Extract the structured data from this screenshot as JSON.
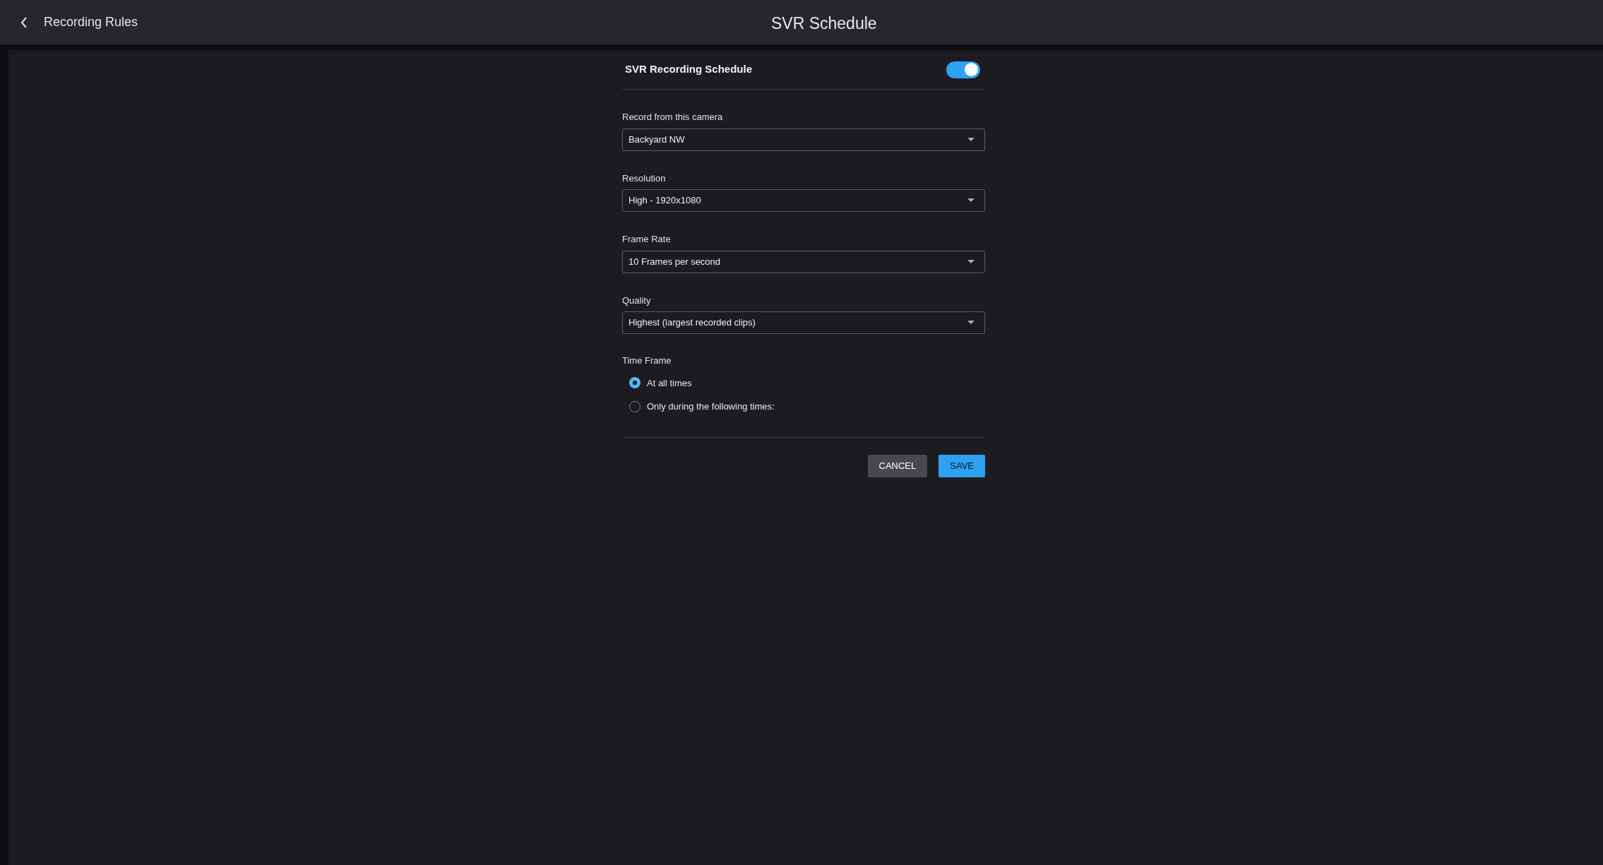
{
  "header": {
    "back_label": "Recording Rules",
    "title": "SVR Schedule"
  },
  "schedule": {
    "title": "SVR Recording Schedule",
    "on": true
  },
  "fields": [
    {
      "label": "Record from this camera",
      "value": "Backyard NW"
    },
    {
      "label": "Resolution",
      "value": "High - 1920x1080"
    },
    {
      "label": "Frame Rate",
      "value": "10 Frames per second"
    },
    {
      "label": "Quality",
      "value": "Highest (largest recorded clips)"
    }
  ],
  "time_frame": {
    "label": "Time Frame",
    "options": [
      {
        "label": "At all times",
        "selected": true
      },
      {
        "label": "Only during the following times:",
        "selected": false
      }
    ]
  },
  "buttons": [
    {
      "label": "CANCEL",
      "kind": "secondary"
    },
    {
      "label": "SAVE",
      "kind": "primary"
    }
  ]
}
